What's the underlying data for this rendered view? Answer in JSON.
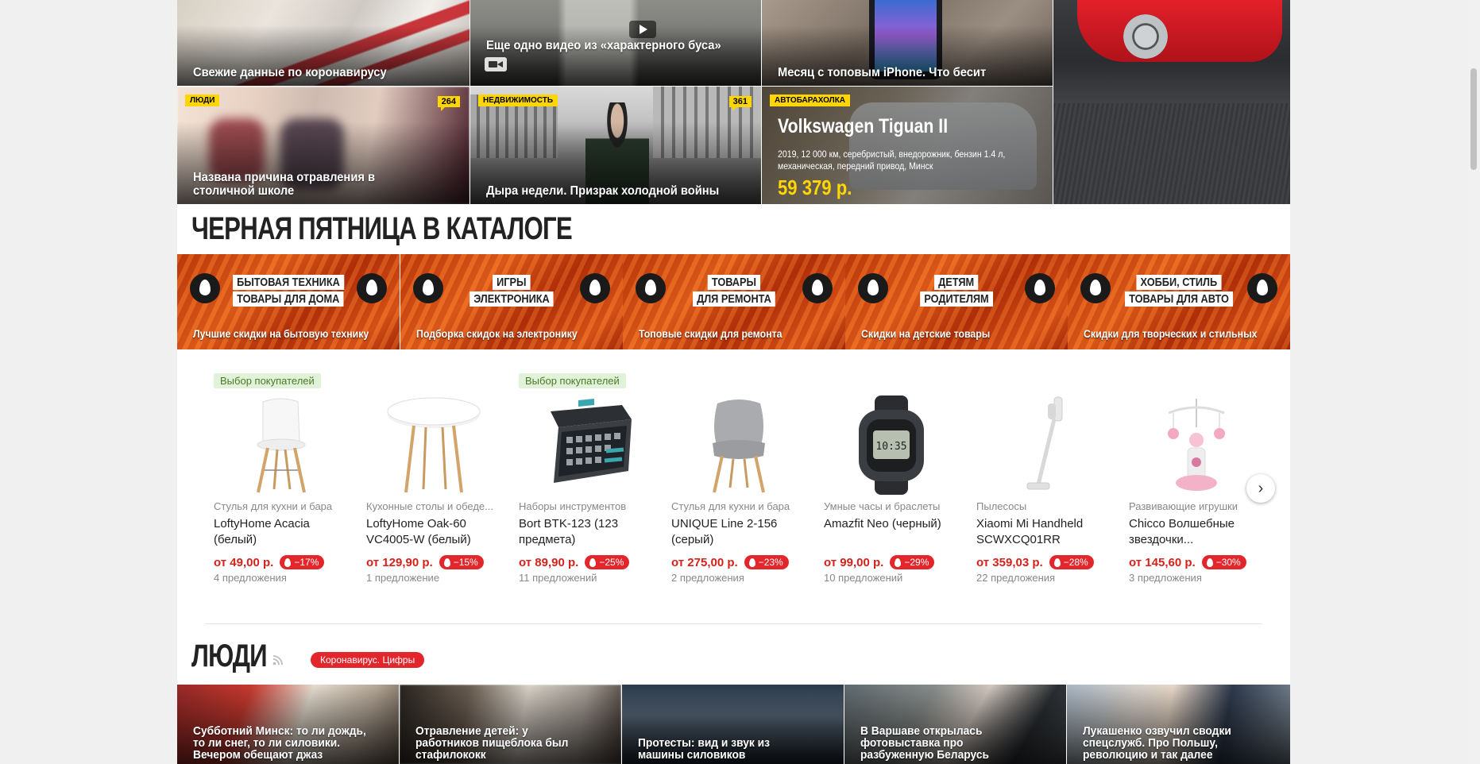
{
  "news_top": [
    {
      "title": "Свежие данные по коронавирусу"
    },
    {
      "title": "Еще одно видео из «характерного буса»"
    },
    {
      "title": "Месяц с топовым iPhone. Что бесит"
    }
  ],
  "news_mid": [
    {
      "tag": "Люди",
      "comments": "264",
      "title": "Названа причина отравления в столичной школе"
    },
    {
      "tag": "Недвижимость",
      "comments": "361",
      "title": "Дыра недели. Призрак холодной войны"
    }
  ],
  "auto_ad": {
    "tag": "Автобарахолка",
    "title": "Volkswagen Tiguan II",
    "description": "2019, 12 000 км, серебристый, внедорожник, бензин 1.4 л, механическая, передний привод, Минск",
    "price": "59 379 р."
  },
  "catalog": {
    "heading": "ЧЕРНАЯ ПЯТНИЦА В КАТАЛОГЕ",
    "banners": [
      {
        "line1": "БЫТОВАЯ ТЕХНИКА",
        "line2": "ТОВАРЫ ДЛЯ ДОМА",
        "caption": "Лучшие скидки на бытовую технику"
      },
      {
        "line1": "ИГРЫ",
        "line2": "ЭЛЕКТРОНИКА",
        "caption": "Подборка скидок на электронику"
      },
      {
        "line1": "ТОВАРЫ",
        "line2": "ДЛЯ РЕМОНТА",
        "caption": "Топовые скидки для ремонта"
      },
      {
        "line1": "ДЕТЯМ",
        "line2": "РОДИТЕЛЯМ",
        "caption": "Скидки на детские товары"
      },
      {
        "line1": "ХОББИ, СТИЛЬ",
        "line2": "ТОВАРЫ ДЛЯ АВТО",
        "caption": "Скидки для творческих и стильных"
      }
    ],
    "products": [
      {
        "badge": "Выбор покупателей",
        "category": "Стулья для кухни и бара",
        "name": "LoftyHome Acacia (белый)",
        "price": "от 49,00 р.",
        "discount": "−17%",
        "offers": "4 предложения"
      },
      {
        "badge": "",
        "category": "Кухонные столы и обеде...",
        "name": "LoftyHome Oak-60 VC4005-W (белый)",
        "price": "от 129,90 р.",
        "discount": "−15%",
        "offers": "1 предложение"
      },
      {
        "badge": "Выбор покупателей",
        "category": "Наборы инструментов",
        "name": "Bort BTK-123 (123 предмета)",
        "price": "от 89,90 р.",
        "discount": "−25%",
        "offers": "11 предложений"
      },
      {
        "badge": "",
        "category": "Стулья для кухни и бара",
        "name": "UNIQUE Line 2-156 (серый)",
        "price": "от 275,00 р.",
        "discount": "−23%",
        "offers": "2 предложения"
      },
      {
        "badge": "",
        "category": "Умные часы и браслеты",
        "name": "Amazfit Neo (черный)",
        "price": "от 99,00 р.",
        "discount": "−29%",
        "offers": "10 предложений"
      },
      {
        "badge": "",
        "category": "Пылесосы",
        "name": "Xiaomi Mi Handheld SCWXCQ01RR",
        "price": "от 359,03 р.",
        "discount": "−28%",
        "offers": "22 предложения"
      },
      {
        "badge": "",
        "category": "Развивающие игрушки",
        "name": "Chicco Волшебные звездочки...",
        "price": "от 145,60 р.",
        "discount": "−30%",
        "offers": "3 предложения"
      }
    ],
    "next_icon": "chevron-right-icon"
  },
  "people": {
    "heading": "ЛЮДИ",
    "pill": "Коронавирус. Цифры",
    "tiles": [
      {
        "title": "Субботний Минск: то ли дождь, то ли снег, то ли силовики. Вечером обещают джаз"
      },
      {
        "title": "Отравление детей: у работников пищеблока был стафилококк"
      },
      {
        "title": "Протесты: вид и звук из машины силовиков"
      },
      {
        "title": "В Варшаве открылась фотовыставка про разбуженную Беларусь"
      },
      {
        "title": "Лукашенко озвучил сводки спецслужб. Про Польшу, революцию и так далее"
      }
    ]
  },
  "colors": {
    "accent_red": "#e3262b",
    "tag_yellow": "#ffd600",
    "badge_green_bg": "#e2f2d8"
  }
}
